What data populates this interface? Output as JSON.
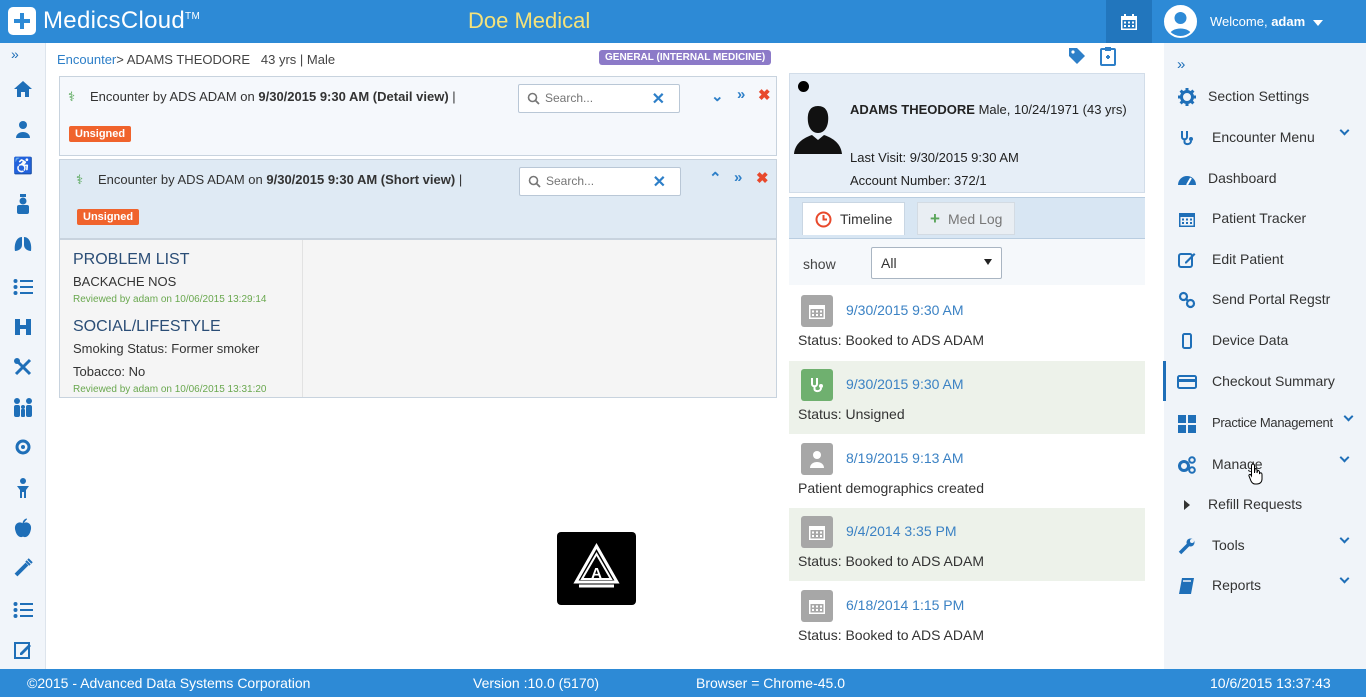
{
  "app": {
    "name": "MedicsCloud",
    "trademark": "TM",
    "practice": "Doe Medical",
    "welcome": "Welcome,",
    "user": "adam"
  },
  "breadcrumb": {
    "link": "Encounter",
    "patient": "> ADAMS THEODORE",
    "age": "43 yrs",
    "sep": "|",
    "sex": "Male"
  },
  "specialty_badge": "GENERAL (INTERNAL MEDICINE)",
  "encounters": [
    {
      "prefix": "Encounter by ADS ADAM on ",
      "datetime": "9/30/2015 9:30 AM (Detail view)",
      "suffix": " |",
      "status": "Unsigned",
      "search_placeholder": "Search..."
    },
    {
      "prefix": "Encounter by ADS ADAM on ",
      "datetime": "9/30/2015 9:30 AM (Short view)",
      "suffix": " |",
      "status": "Unsigned",
      "search_placeholder": "Search..."
    }
  ],
  "sections": {
    "problem_list": {
      "heading": "PROBLEM LIST",
      "item": "BACKACHE NOS",
      "reviewed": "Reviewed by adam on 10/06/2015 13:29:14"
    },
    "social": {
      "heading": "SOCIAL/LIFESTYLE",
      "smoking": "Smoking Status: Former smoker",
      "tobacco": "Tobacco: No",
      "reviewed": "Reviewed by adam on 10/06/2015 13:31:20"
    }
  },
  "patient": {
    "name": "ADAMS THEODORE",
    "details": " Male, 10/24/1971 (43 yrs)",
    "last_visit": "Last Visit: 9/30/2015 9:30 AM",
    "account": "Account Number: 372/1"
  },
  "tabs": {
    "timeline": "Timeline",
    "medlog": "Med Log"
  },
  "filter": {
    "label": "show",
    "value": "All"
  },
  "timeline": [
    {
      "icon": "calendar-icon",
      "date": "9/30/2015 9:30 AM",
      "status": "Status: Booked to ADS ADAM"
    },
    {
      "icon": "stethoscope-icon",
      "date": "9/30/2015 9:30 AM",
      "status": "Status: Unsigned"
    },
    {
      "icon": "person-icon",
      "date": "8/19/2015 9:13 AM",
      "status": "Patient demographics created"
    },
    {
      "icon": "calendar-icon",
      "date": "9/4/2014 3:35 PM",
      "status": "Status: Booked to ADS ADAM"
    },
    {
      "icon": "calendar-icon",
      "date": "6/18/2014 1:15 PM",
      "status": "Status: Booked to ADS ADAM"
    }
  ],
  "right_menu": [
    {
      "label": "Section Settings",
      "icon": "gear-icon",
      "chevron": false
    },
    {
      "label": "Encounter Menu",
      "icon": "stethoscope-icon",
      "chevron": true
    },
    {
      "label": "Dashboard",
      "icon": "dashboard-icon",
      "chevron": false
    },
    {
      "label": "Patient Tracker",
      "icon": "calendar-icon",
      "chevron": false
    },
    {
      "label": "Edit Patient",
      "icon": "edit-icon",
      "chevron": false
    },
    {
      "label": "Send Portal Regstr",
      "icon": "link-icon",
      "chevron": false
    },
    {
      "label": "Device Data",
      "icon": "phone-icon",
      "chevron": false
    },
    {
      "label": "Checkout Summary",
      "icon": "card-icon",
      "chevron": false
    },
    {
      "label": "Practice Management",
      "icon": "grid-icon",
      "chevron": true
    },
    {
      "label": "Manage",
      "icon": "gears-icon",
      "chevron": true
    },
    {
      "label": "Refill Requests",
      "icon": "caret-right-icon",
      "chevron": false
    },
    {
      "label": "Tools",
      "icon": "wrench-icon",
      "chevron": true
    },
    {
      "label": "Reports",
      "icon": "book-icon",
      "chevron": true
    }
  ],
  "footer": {
    "copyright": "©2015 - Advanced Data Systems Corporation",
    "version": "Version :10.0 (5170)",
    "browser": "Browser = Chrome-45.0",
    "datetime": "10/6/2015 13:37:43"
  },
  "colors": {
    "header_blue": "#2d8ad6",
    "unsigned_orange": "#f0632c",
    "badge_purple": "#8c7ac8",
    "link_blue": "#3b82c4"
  }
}
